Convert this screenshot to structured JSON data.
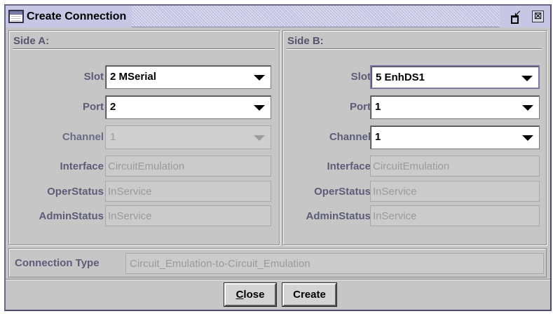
{
  "window": {
    "title": "Create Connection",
    "restore_icon": "restore-icon",
    "close_glyph": "⊠"
  },
  "side_a": {
    "title": "Side A:",
    "slot": {
      "label": "Slot",
      "value": "2 MSerial"
    },
    "port": {
      "label": "Port",
      "value": "2"
    },
    "channel": {
      "label": "Channel",
      "value": "1",
      "disabled": true
    },
    "interface": {
      "label": "Interface",
      "value": "CircuitEmulation"
    },
    "oper_status": {
      "label": "OperStatus",
      "value": "InService"
    },
    "admin_status": {
      "label": "AdminStatus",
      "value": "InService"
    }
  },
  "side_b": {
    "title": "Side B:",
    "slot": {
      "label": "Slot",
      "value": "5 EnhDS1"
    },
    "port": {
      "label": "Port",
      "value": "1"
    },
    "channel": {
      "label": "Channel",
      "value": "1",
      "disabled": false
    },
    "interface": {
      "label": "Interface",
      "value": "CircuitEmulation"
    },
    "oper_status": {
      "label": "OperStatus",
      "value": "InService"
    },
    "admin_status": {
      "label": "AdminStatus",
      "value": "InService"
    }
  },
  "connection": {
    "label": "Connection Type",
    "value": "Circuit_Emulation-to-Circuit_Emulation"
  },
  "buttons": {
    "close_mnemonic": "C",
    "close_rest": "lose",
    "create": "Create"
  },
  "colors": {
    "title_bar": "#c7c7e5",
    "panel_bg": "#c6c6c6",
    "label": "#5c5c78"
  }
}
